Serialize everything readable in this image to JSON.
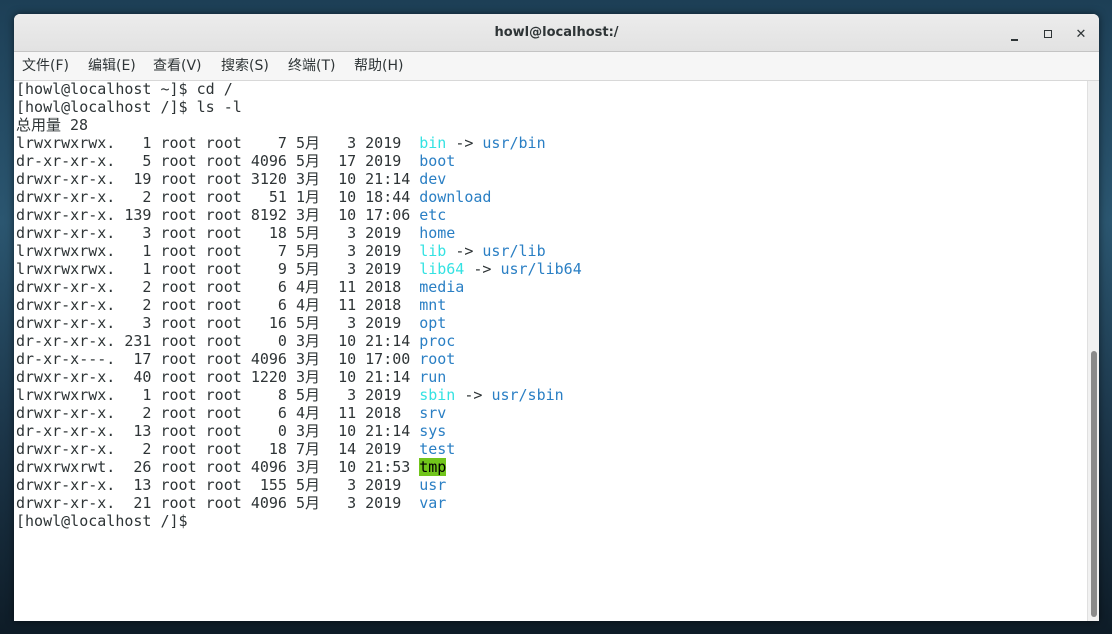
{
  "window": {
    "title": "howl@localhost:/"
  },
  "menubar": {
    "items": [
      "文件(F)",
      "编辑(E)",
      "查看(V)",
      "搜索(S)",
      "终端(T)",
      "帮助(H)"
    ]
  },
  "terminal": {
    "prompt1": "[howl@localhost ~]$ cd /",
    "prompt2": "[howl@localhost /]$ ls -l",
    "total": "总用量 28",
    "entries": [
      {
        "perm": "lrwxrwxrwx.",
        "links": "  1",
        "owner": "root",
        "group": "root",
        "size": "   7",
        "month": "5月",
        "day": " 3",
        "time": "2019",
        "name": "bin",
        "arrow": "->",
        "target": "usr/bin",
        "type": "link"
      },
      {
        "perm": "dr-xr-xr-x.",
        "links": "  5",
        "owner": "root",
        "group": "root",
        "size": "4096",
        "month": "5月",
        "day": "17",
        "time": "2019",
        "name": "boot",
        "type": "dir"
      },
      {
        "perm": "drwxr-xr-x.",
        "links": " 19",
        "owner": "root",
        "group": "root",
        "size": "3120",
        "month": "3月",
        "day": "10",
        "time": "21:14",
        "name": "dev",
        "type": "dir"
      },
      {
        "perm": "drwxr-xr-x.",
        "links": "  2",
        "owner": "root",
        "group": "root",
        "size": "  51",
        "month": "1月",
        "day": "10",
        "time": "18:44",
        "name": "download",
        "type": "dir"
      },
      {
        "perm": "drwxr-xr-x.",
        "links": "139",
        "owner": "root",
        "group": "root",
        "size": "8192",
        "month": "3月",
        "day": "10",
        "time": "17:06",
        "name": "etc",
        "type": "dir"
      },
      {
        "perm": "drwxr-xr-x.",
        "links": "  3",
        "owner": "root",
        "group": "root",
        "size": "  18",
        "month": "5月",
        "day": " 3",
        "time": "2019",
        "name": "home",
        "type": "dir"
      },
      {
        "perm": "lrwxrwxrwx.",
        "links": "  1",
        "owner": "root",
        "group": "root",
        "size": "   7",
        "month": "5月",
        "day": " 3",
        "time": "2019",
        "name": "lib",
        "arrow": "->",
        "target": "usr/lib",
        "type": "link"
      },
      {
        "perm": "lrwxrwxrwx.",
        "links": "  1",
        "owner": "root",
        "group": "root",
        "size": "   9",
        "month": "5月",
        "day": " 3",
        "time": "2019",
        "name": "lib64",
        "arrow": "->",
        "target": "usr/lib64",
        "type": "link"
      },
      {
        "perm": "drwxr-xr-x.",
        "links": "  2",
        "owner": "root",
        "group": "root",
        "size": "   6",
        "month": "4月",
        "day": "11",
        "time": "2018",
        "name": "media",
        "type": "dir"
      },
      {
        "perm": "drwxr-xr-x.",
        "links": "  2",
        "owner": "root",
        "group": "root",
        "size": "   6",
        "month": "4月",
        "day": "11",
        "time": "2018",
        "name": "mnt",
        "type": "dir"
      },
      {
        "perm": "drwxr-xr-x.",
        "links": "  3",
        "owner": "root",
        "group": "root",
        "size": "  16",
        "month": "5月",
        "day": " 3",
        "time": "2019",
        "name": "opt",
        "type": "dir"
      },
      {
        "perm": "dr-xr-xr-x.",
        "links": "231",
        "owner": "root",
        "group": "root",
        "size": "   0",
        "month": "3月",
        "day": "10",
        "time": "21:14",
        "name": "proc",
        "type": "dir"
      },
      {
        "perm": "dr-xr-x---.",
        "links": " 17",
        "owner": "root",
        "group": "root",
        "size": "4096",
        "month": "3月",
        "day": "10",
        "time": "17:00",
        "name": "root",
        "type": "dir"
      },
      {
        "perm": "drwxr-xr-x.",
        "links": " 40",
        "owner": "root",
        "group": "root",
        "size": "1220",
        "month": "3月",
        "day": "10",
        "time": "21:14",
        "name": "run",
        "type": "dir"
      },
      {
        "perm": "lrwxrwxrwx.",
        "links": "  1",
        "owner": "root",
        "group": "root",
        "size": "   8",
        "month": "5月",
        "day": " 3",
        "time": "2019",
        "name": "sbin",
        "arrow": "->",
        "target": "usr/sbin",
        "type": "link"
      },
      {
        "perm": "drwxr-xr-x.",
        "links": "  2",
        "owner": "root",
        "group": "root",
        "size": "   6",
        "month": "4月",
        "day": "11",
        "time": "2018",
        "name": "srv",
        "type": "dir"
      },
      {
        "perm": "dr-xr-xr-x.",
        "links": " 13",
        "owner": "root",
        "group": "root",
        "size": "   0",
        "month": "3月",
        "day": "10",
        "time": "21:14",
        "name": "sys",
        "type": "dir"
      },
      {
        "perm": "drwxr-xr-x.",
        "links": "  2",
        "owner": "root",
        "group": "root",
        "size": "  18",
        "month": "7月",
        "day": "14",
        "time": "2019",
        "name": "test",
        "type": "dir"
      },
      {
        "perm": "drwxrwxrwt.",
        "links": " 26",
        "owner": "root",
        "group": "root",
        "size": "4096",
        "month": "3月",
        "day": "10",
        "time": "21:53",
        "name": "tmp",
        "type": "sticky"
      },
      {
        "perm": "drwxr-xr-x.",
        "links": " 13",
        "owner": "root",
        "group": "root",
        "size": " 155",
        "month": "5月",
        "day": " 3",
        "time": "2019",
        "name": "usr",
        "type": "dir"
      },
      {
        "perm": "drwxr-xr-x.",
        "links": " 21",
        "owner": "root",
        "group": "root",
        "size": "4096",
        "month": "5月",
        "day": " 3",
        "time": "2019",
        "name": "var",
        "type": "dir"
      }
    ],
    "prompt3": "[howl@localhost /]$ "
  },
  "colors": {
    "link": "#34e2e2",
    "dir": "#2a7fc4",
    "sticky_bg": "#71c51b"
  },
  "icons": {
    "minimize": "minimize-icon",
    "maximize": "maximize-icon",
    "close": "close-icon"
  }
}
